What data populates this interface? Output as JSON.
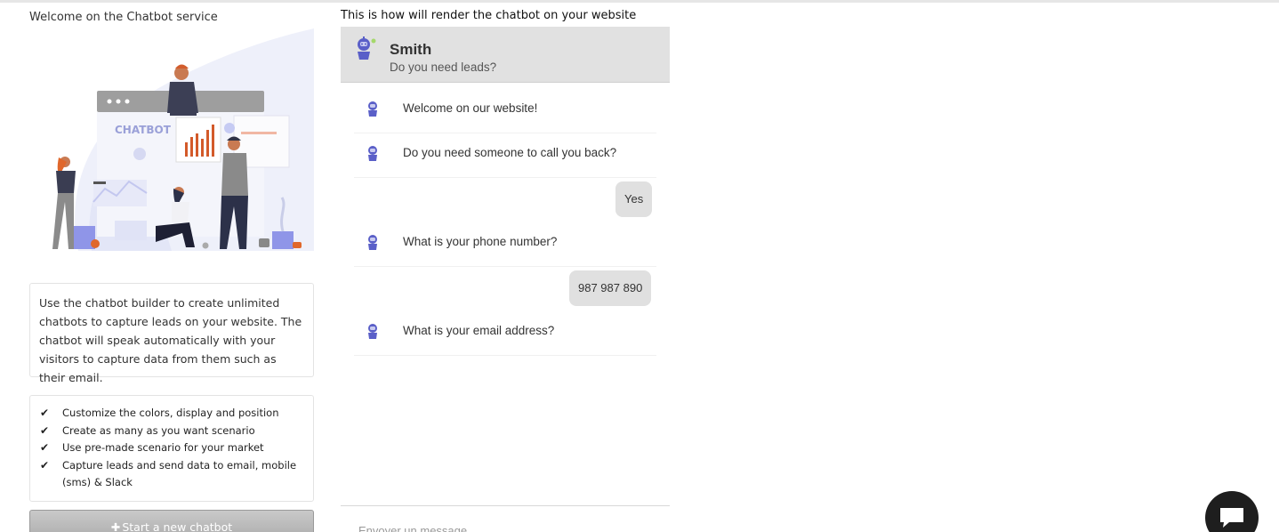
{
  "left": {
    "welcome": "Welcome on the Chatbot service",
    "illustration_label": "CHATBOT",
    "description": "Use the chatbot builder to create unlimited chatbots to capture leads on your website. The chatbot will speak automatically with your visitors to capture data from them such as their email.",
    "features": [
      "Customize the colors, display and position",
      "Create as many as you want scenario",
      "Use pre-made scenario for your market",
      "Capture leads and send data to email, mobile (sms) & Slack"
    ],
    "start_button": "Start a new chatbot"
  },
  "preview": {
    "title": "This is how will render the chatbot on your website",
    "header": {
      "name": "Smith",
      "subtitle": "Do you need leads?"
    },
    "messages": [
      {
        "text": "Welcome on our website!"
      },
      {
        "text": "Do you need someone to call you back?"
      },
      {
        "text": "What is your phone number?"
      },
      {
        "text": "What is your email address?"
      }
    ],
    "replies": [
      "Yes",
      "987 987 890"
    ],
    "input_placeholder": "Envoyer un message"
  },
  "colors": {
    "bot_accent": "#5a5fc8",
    "header_bg": "#e1e1e1",
    "reply_bg": "#e0e0e0",
    "chat_button_bg": "#1e1e1e"
  },
  "icons": {
    "check": "check-icon",
    "plus": "plus-icon",
    "bot_avatar": "robot-icon",
    "chat_button": "chat-bubble-icon"
  }
}
